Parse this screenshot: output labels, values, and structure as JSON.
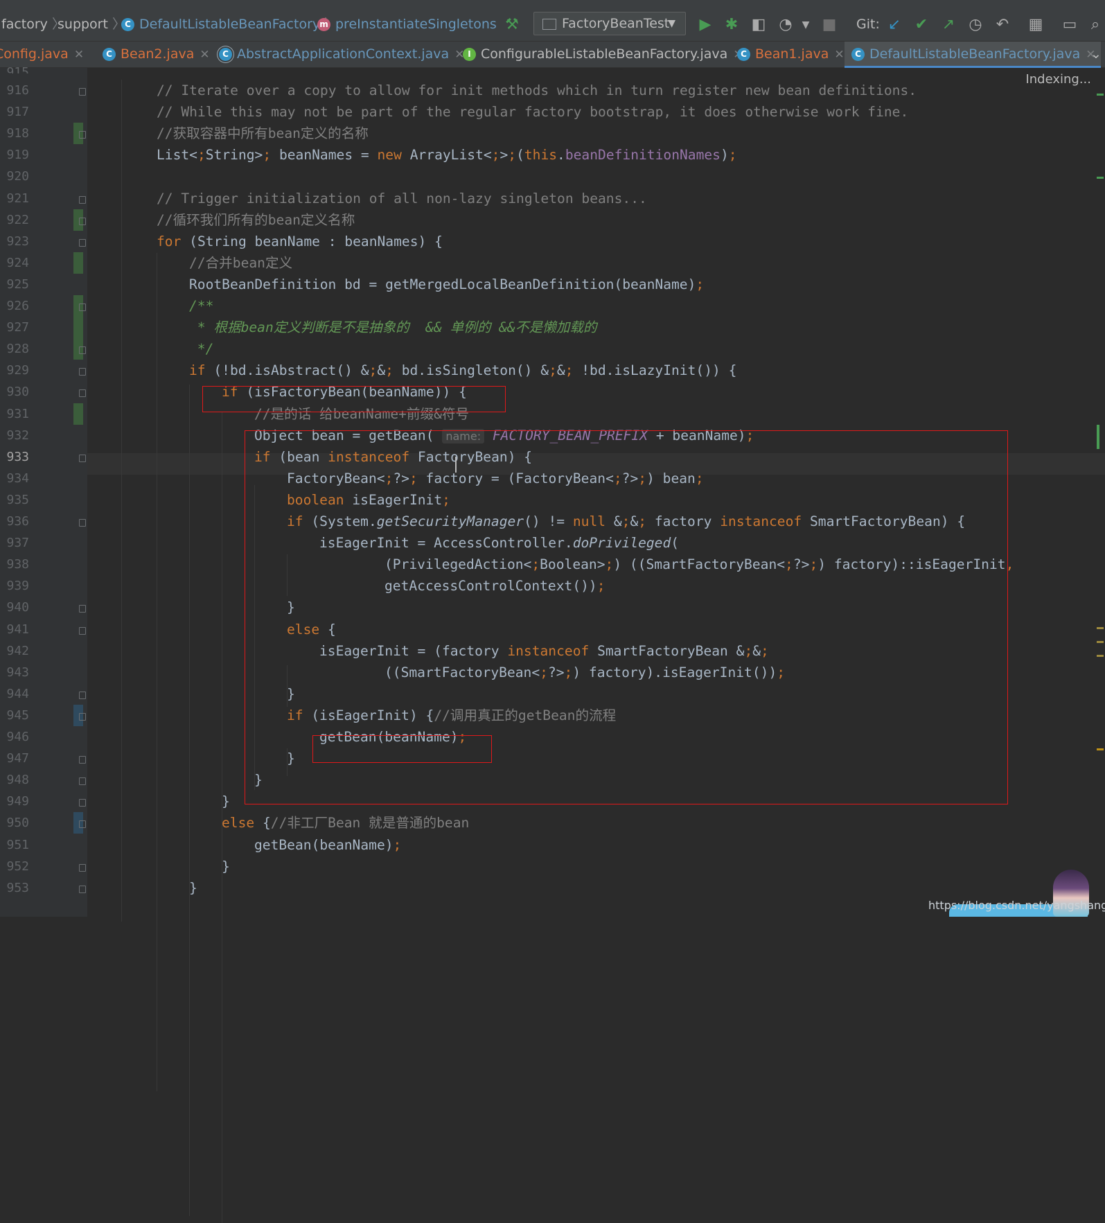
{
  "breadcrumb": {
    "items": [
      "factory",
      "support",
      "DefaultListableBeanFactory",
      "preInstantiateSingletons"
    ]
  },
  "toolbar": {
    "run_config": "FactoryBeanTest",
    "git_label": "Git:"
  },
  "tabs": [
    {
      "label": "Config.java",
      "color": "#d9713d"
    },
    {
      "label": "Bean2.java",
      "color": "#d9713d"
    },
    {
      "label": "AbstractApplicationContext.java",
      "color": "#6897bb"
    },
    {
      "label": "ConfigurableListableBeanFactory.java",
      "color": "#bbbbbb"
    },
    {
      "label": "Bean1.java",
      "color": "#d9713d"
    },
    {
      "label": "DefaultListableBeanFactory.java",
      "color": "#6897bb"
    }
  ],
  "status": {
    "indexing": "Indexing..."
  },
  "editor": {
    "first_partial_line": "915",
    "lines": [
      {
        "n": "916",
        "text": "// Iterate over a copy to allow for init methods which in turn register new bean definitions."
      },
      {
        "n": "917",
        "text": "// While this may not be part of the regular factory bootstrap, it does otherwise work fine."
      },
      {
        "n": "918",
        "text": "//获取容器中所有bean定义的名称"
      },
      {
        "n": "919",
        "text": "List<String> beanNames = new ArrayList<>(this.beanDefinitionNames);"
      },
      {
        "n": "920",
        "text": ""
      },
      {
        "n": "921",
        "text": "// Trigger initialization of all non-lazy singleton beans..."
      },
      {
        "n": "922",
        "text": "//循环我们所有的bean定义名称"
      },
      {
        "n": "923",
        "text": "for (String beanName : beanNames) {"
      },
      {
        "n": "924",
        "text": "//合并bean定义"
      },
      {
        "n": "925",
        "text": "RootBeanDefinition bd = getMergedLocalBeanDefinition(beanName);"
      },
      {
        "n": "926",
        "text": "/**"
      },
      {
        "n": "927",
        "text": " * 根据bean定义判断是不是抽象的  && 单例的 &&不是懒加载的"
      },
      {
        "n": "928",
        "text": " */"
      },
      {
        "n": "929",
        "text": "if (!bd.isAbstract() && bd.isSingleton() && !bd.isLazyInit()) {"
      },
      {
        "n": "930",
        "text": "if (isFactoryBean(beanName)) {"
      },
      {
        "n": "931",
        "text": "//是的话 给beanName+前缀&符号"
      },
      {
        "n": "932",
        "text": "Object bean = getBean( name: FACTORY_BEAN_PREFIX + beanName);"
      },
      {
        "n": "933",
        "text": "if (bean instanceof FactoryBean) {"
      },
      {
        "n": "934",
        "text": "FactoryBean<?> factory = (FactoryBean<?>) bean;"
      },
      {
        "n": "935",
        "text": "boolean isEagerInit;"
      },
      {
        "n": "936",
        "text": "if (System.getSecurityManager() != null && factory instanceof SmartFactoryBean) {"
      },
      {
        "n": "937",
        "text": "isEagerInit = AccessController.doPrivileged("
      },
      {
        "n": "938",
        "text": "(PrivilegedAction<Boolean>) ((SmartFactoryBean<?>) factory)::isEagerInit,"
      },
      {
        "n": "939",
        "text": "getAccessControlContext());"
      },
      {
        "n": "940",
        "text": "}"
      },
      {
        "n": "941",
        "text": "else {"
      },
      {
        "n": "942",
        "text": "isEagerInit = (factory instanceof SmartFactoryBean &&"
      },
      {
        "n": "943",
        "text": "((SmartFactoryBean<?>) factory).isEagerInit());"
      },
      {
        "n": "944",
        "text": "}"
      },
      {
        "n": "945",
        "text": "if (isEagerInit) {//调用真正的getBean的流程"
      },
      {
        "n": "946",
        "text": "getBean(beanName);"
      },
      {
        "n": "947",
        "text": "}"
      },
      {
        "n": "948",
        "text": "}"
      },
      {
        "n": "949",
        "text": "}"
      },
      {
        "n": "950",
        "text": "else {//非工厂Bean 就是普通的bean"
      },
      {
        "n": "951",
        "text": "getBean(beanName);"
      },
      {
        "n": "952",
        "text": "}"
      },
      {
        "n": "953",
        "text": "}"
      }
    ],
    "current_line": "933"
  },
  "watermark": "https://blog.csdn.net/yangshangwei"
}
